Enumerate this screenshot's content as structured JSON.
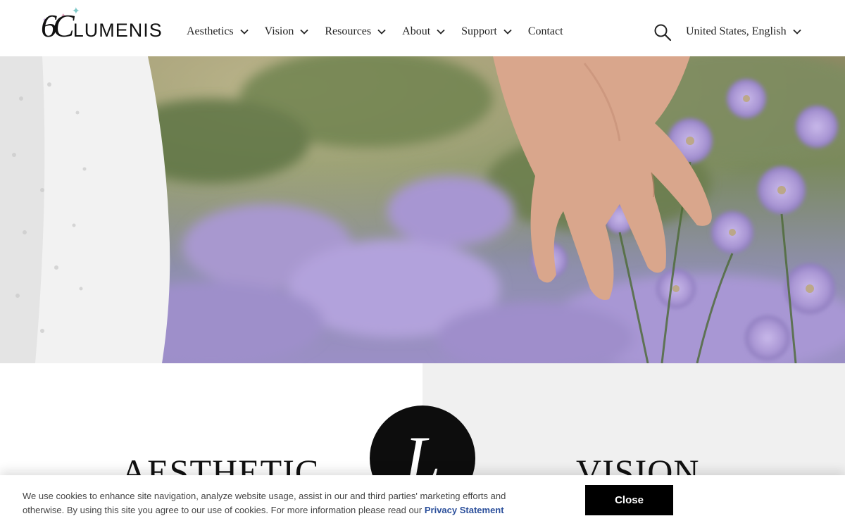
{
  "brand": {
    "logo_mark": "6C",
    "logo_text": "LUMENIS"
  },
  "nav": {
    "items": [
      {
        "label": "Aesthetics",
        "has_dropdown": true
      },
      {
        "label": "Vision",
        "has_dropdown": true
      },
      {
        "label": "Resources",
        "has_dropdown": true
      },
      {
        "label": "About",
        "has_dropdown": true
      },
      {
        "label": "Support",
        "has_dropdown": true
      },
      {
        "label": "Contact",
        "has_dropdown": false
      }
    ],
    "search_icon": "search-icon",
    "locale": "United States, English"
  },
  "hero": {
    "image": "hand-brushing-purple-flowers",
    "colors": {
      "flower": "#a996d4",
      "foliage": "#6f7f59",
      "dress": "#f2f2f2"
    }
  },
  "sections": {
    "left_heading": "AESTHETIC",
    "right_heading": "VISION",
    "badge_letter": "L"
  },
  "cookie": {
    "text": "We use cookies to enhance site navigation, analyze website usage, assist in our and third parties' marketing efforts and otherwise. By using this site you agree to our use of cookies. For more information please read our",
    "link": "Privacy Statement",
    "close_label": "Close",
    "link_color": "#2b4f9b"
  }
}
